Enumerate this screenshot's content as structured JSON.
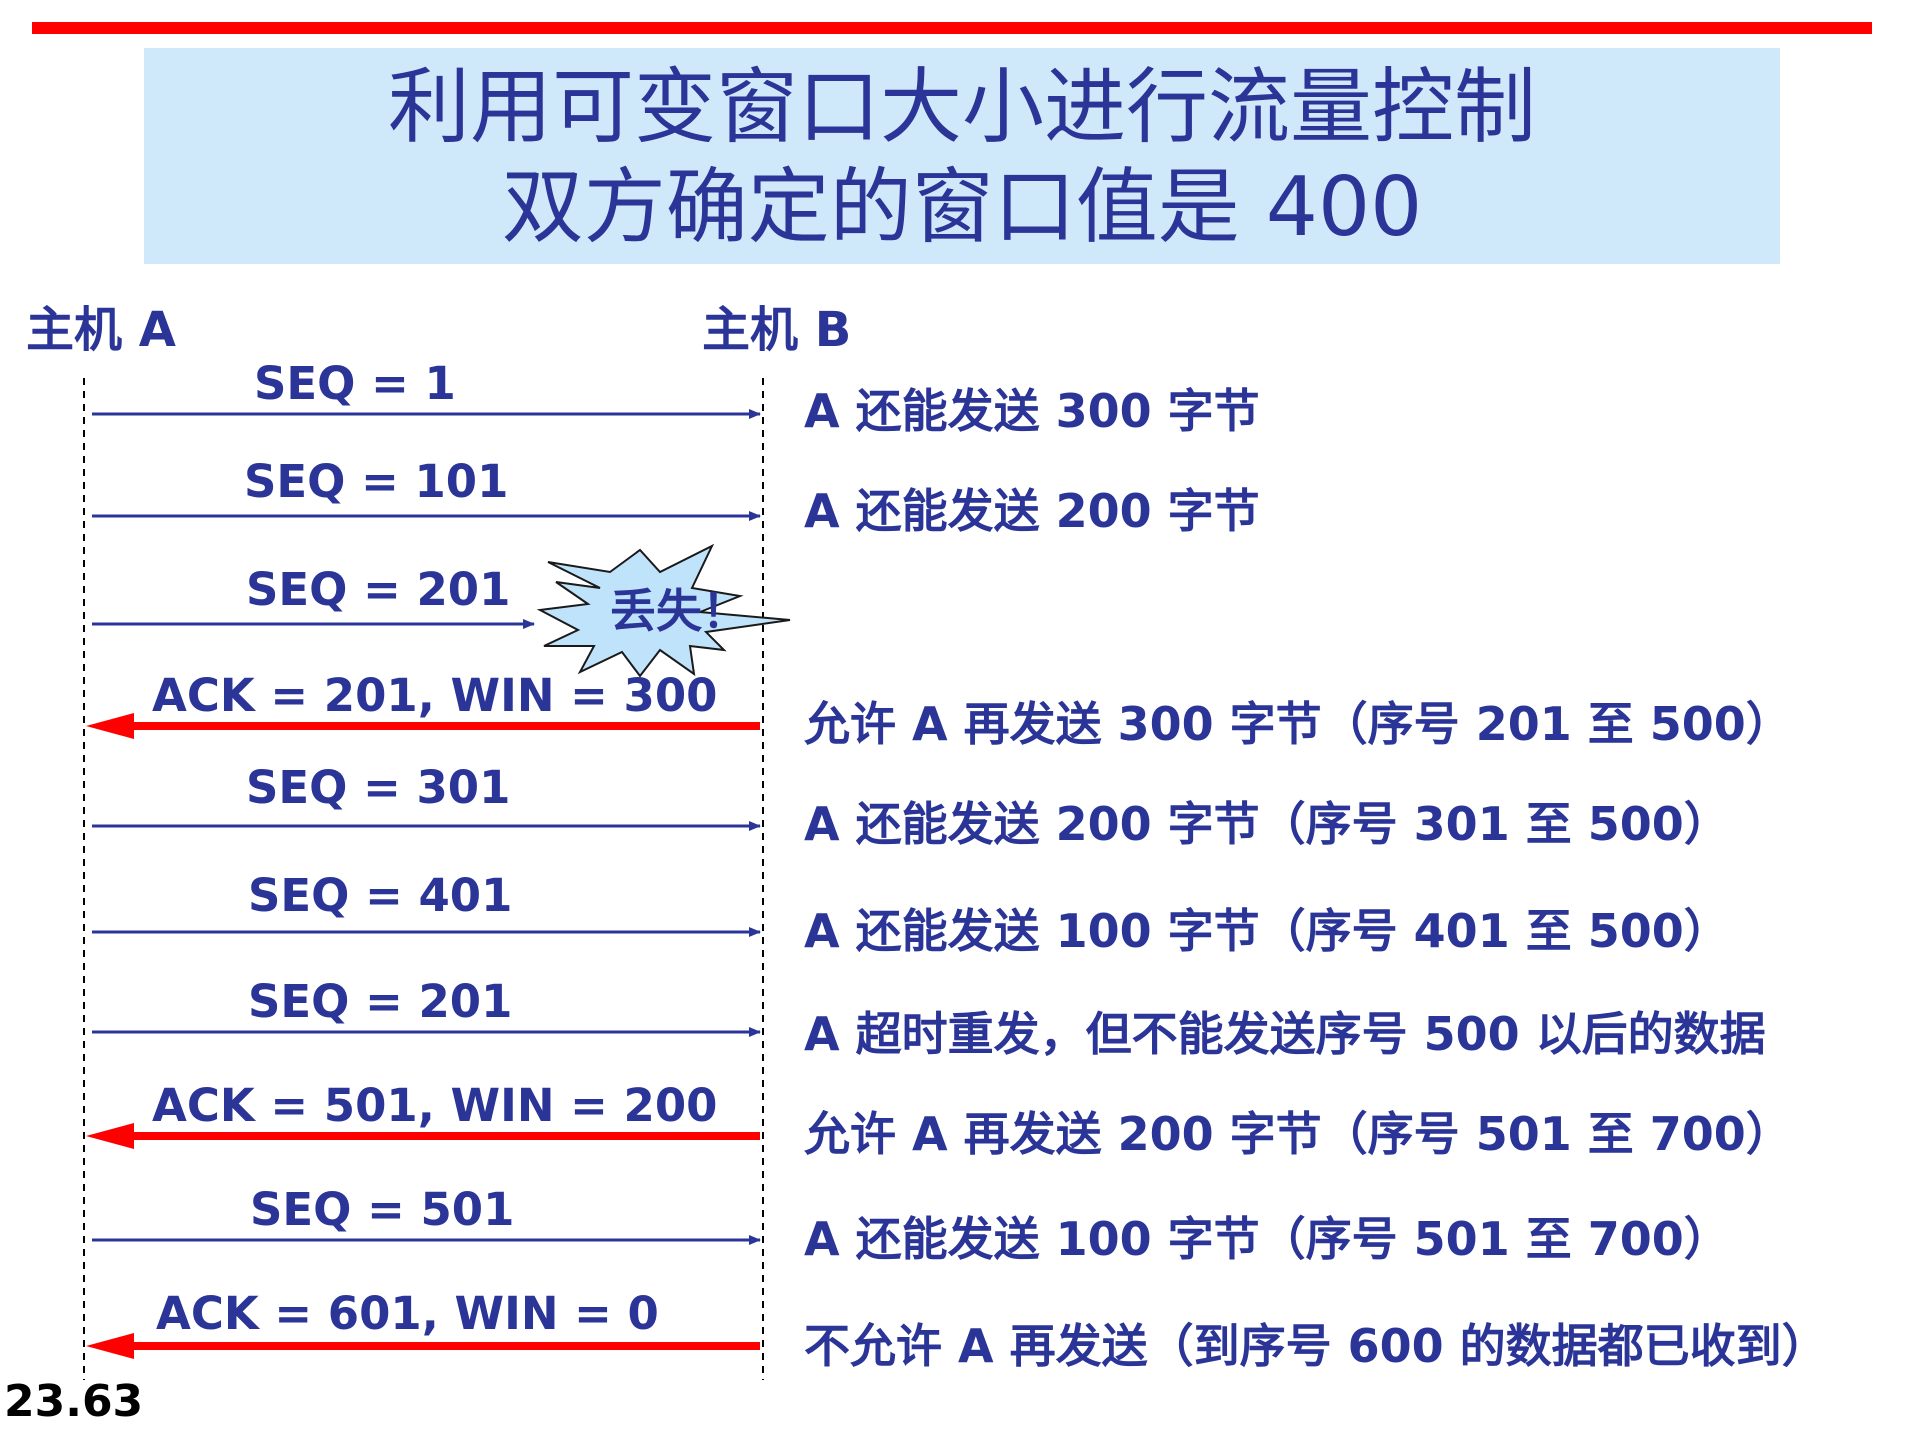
{
  "title": {
    "line1": "利用可变窗口大小进行流量控制",
    "line2": "双方确定的窗口值是 400"
  },
  "hosts": {
    "a": "主机 A",
    "b": "主机 B"
  },
  "lost_label": "丢失！",
  "messages": [
    {
      "label": "SEQ = 1",
      "direction": "A-to-B",
      "note": "A 还能发送 300 字节"
    },
    {
      "label": "SEQ = 101",
      "direction": "A-to-B",
      "note": "A 还能发送 200 字节"
    },
    {
      "label": "SEQ = 201",
      "direction": "A-to-B",
      "lost": true,
      "note": ""
    },
    {
      "label": "ACK = 201, WIN = 300",
      "direction": "B-to-A",
      "note": "允许 A 再发送 300 字节（序号 201 至 500）"
    },
    {
      "label": "SEQ = 301",
      "direction": "A-to-B",
      "note": "A 还能发送 200 字节（序号 301 至 500）"
    },
    {
      "label": "SEQ = 401",
      "direction": "A-to-B",
      "note": "A 还能发送 100 字节（序号 401 至 500）"
    },
    {
      "label": "SEQ = 201",
      "direction": "A-to-B",
      "note": "A 超时重发，但不能发送序号 500 以后的数据"
    },
    {
      "label": "ACK = 501, WIN = 200",
      "direction": "B-to-A",
      "note": "允许 A 再发送 200 字节（序号 501 至 700）"
    },
    {
      "label": "SEQ = 501",
      "direction": "A-to-B",
      "note": "A 还能发送 100 字节（序号 501 至 700）"
    },
    {
      "label": "ACK = 601, WIN = 0",
      "direction": "B-to-A",
      "note": "不允许 A 再发送（到序号 600 的数据都已收到）"
    }
  ],
  "footer_number": "23.63",
  "colors": {
    "accent_red": "#ff0000",
    "text_blue": "#2a3597",
    "title_bg": "#cfe9fb",
    "burst_fill": "#bfe3fb"
  }
}
